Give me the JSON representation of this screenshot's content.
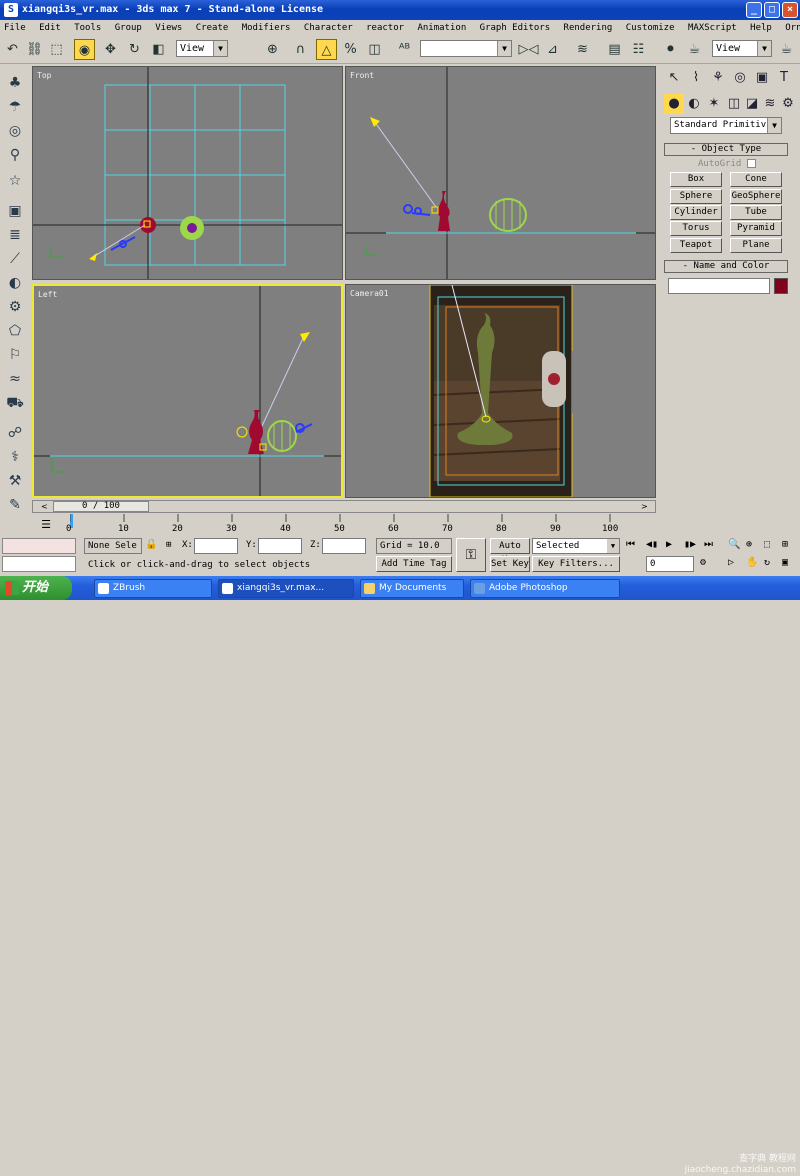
{
  "window": {
    "title": "xiangqi3s_vr.max - 3ds max 7 - Stand-alone License",
    "minimize": "_",
    "maximize": "□",
    "close": "×"
  },
  "menu": [
    "File",
    "Edit",
    "Tools",
    "Group",
    "Views",
    "Create",
    "Modifiers",
    "Character",
    "reactor",
    "Animation",
    "Graph Editors",
    "Rendering",
    "Customize",
    "MAXScript",
    "Help",
    "Ornatrix"
  ],
  "toolbar": {
    "reference_coord": "View",
    "named_selection": "",
    "render_view": "View"
  },
  "viewports": {
    "top": "Top",
    "front": "Front",
    "left": "Left",
    "camera": "Camera01"
  },
  "command_panel": {
    "category_dropdown": "Standard Primitiv",
    "object_type_title": "Object Type",
    "autogrid_label": "AutoGrid",
    "objects": [
      "Box",
      "Cone",
      "Sphere",
      "GeoSphere",
      "Cylinder",
      "Tube",
      "Torus",
      "Pyramid",
      "Teapot",
      "Plane"
    ],
    "name_color_title": "Name and Color",
    "name_value": "",
    "object_color": "#800020"
  },
  "timeline": {
    "frame_counter": "0 / 100",
    "ticks": [
      "0",
      "10",
      "20",
      "30",
      "40",
      "50",
      "60",
      "70",
      "80",
      "90",
      "100"
    ]
  },
  "status": {
    "selection": "None Sele",
    "x_label": "X:",
    "y_label": "Y:",
    "z_label": "Z:",
    "x_value": "",
    "y_value": "",
    "z_value": "",
    "grid": "Grid = 10.0",
    "prompt": "Click or click-and-drag to select objects",
    "add_time_tag": "Add Time Tag",
    "auto_key": "Auto Key",
    "set_key": "Set Key",
    "key_mode": "Selected",
    "key_filters": "Key Filters...",
    "current_frame": "0"
  },
  "taskbar": {
    "start": "开始",
    "tasks": [
      "ZBrush",
      "xiangqi3s_vr.max...",
      "My Documents",
      "Adobe Photoshop"
    ],
    "watermark_line1": "查字典 教程网",
    "watermark_line2": "jiaocheng.chazidian.com"
  },
  "colors": {
    "viewport_bg": "#7f7f7f",
    "grid_cyan": "#53d6e6",
    "model_green": "#9ed84a",
    "model_red": "#a00a30",
    "active_border": "#f0e830",
    "titlebar_blue": "#0a3fb8"
  }
}
